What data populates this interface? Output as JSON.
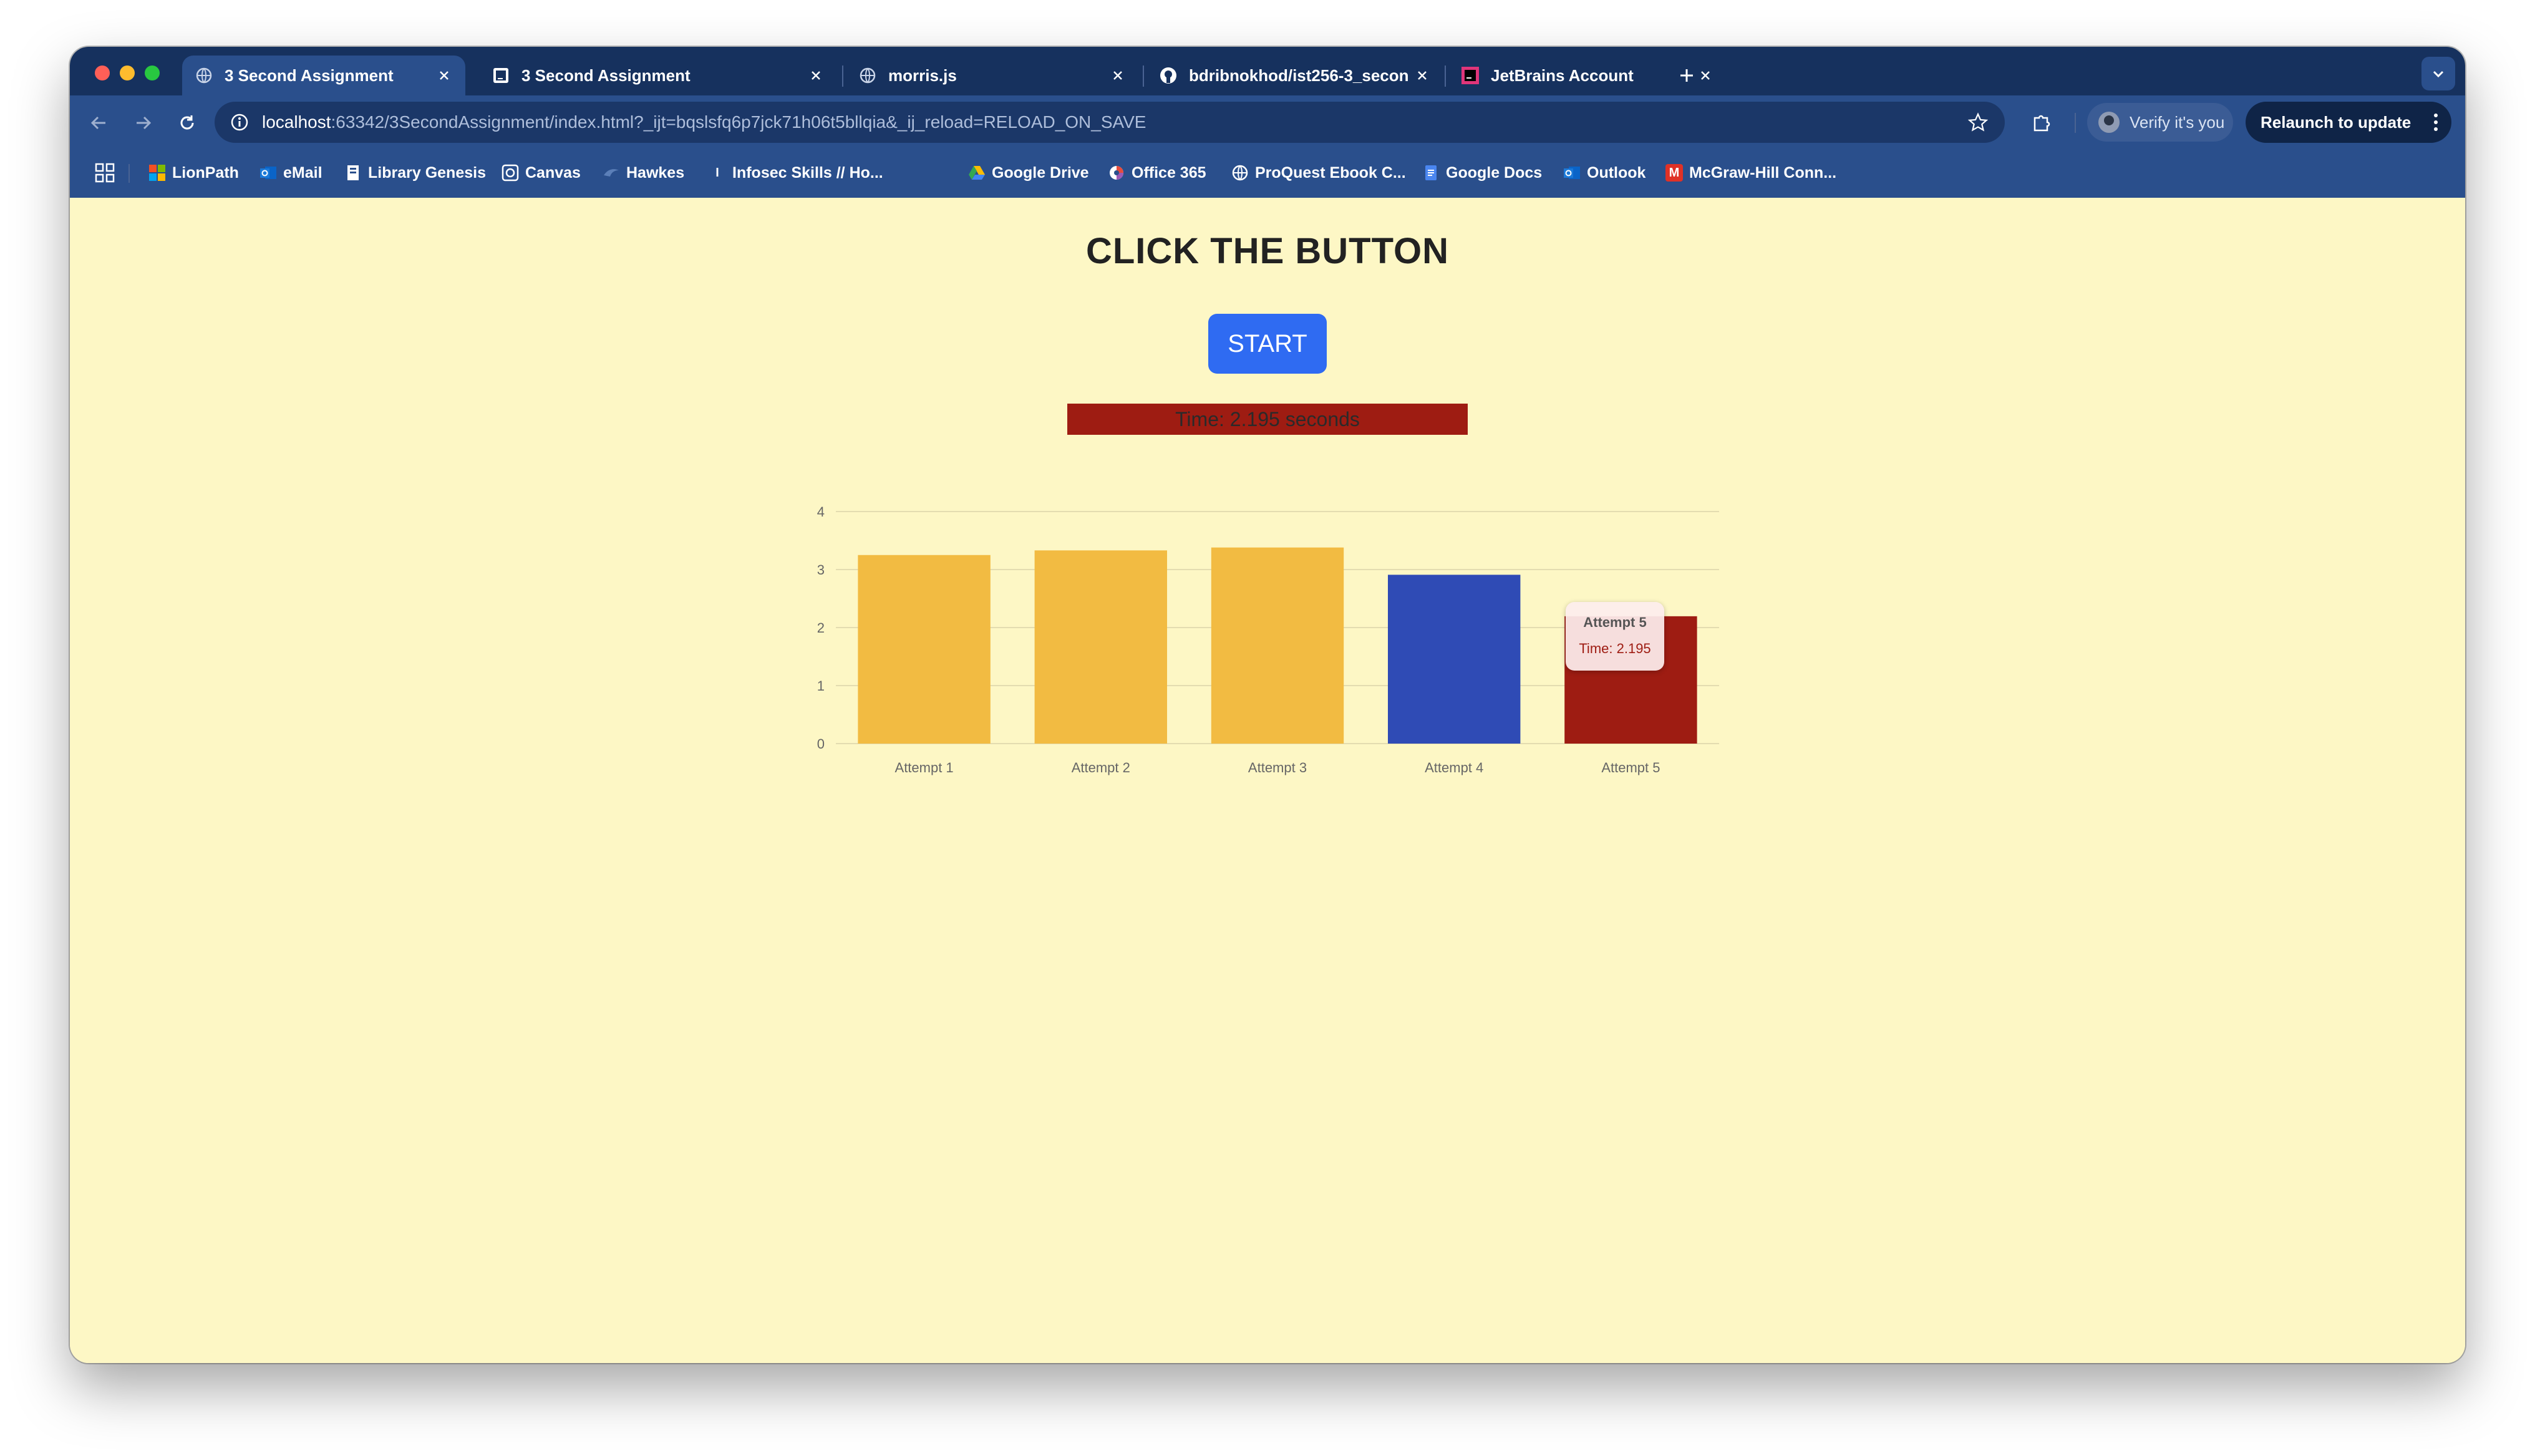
{
  "browser": {
    "tabs": [
      {
        "title": "3 Second Assignment",
        "favicon": "globe-icon",
        "active": true
      },
      {
        "title": "3 Second Assignment",
        "favicon": "webstorm-icon",
        "active": false
      },
      {
        "title": "morris.js",
        "favicon": "globe-icon",
        "active": false
      },
      {
        "title": "bdribnokhod/ist256-3_secon",
        "favicon": "github-icon",
        "active": false
      },
      {
        "title": "JetBrains Account",
        "favicon": "jetbrains-icon",
        "active": false
      }
    ],
    "url_host": "localhost",
    "url_rest": ":63342/3SecondAssignment/index.html?_ijt=bqslsfq6p7jck71h06t5bllqia&_ij_reload=RELOAD_ON_SAVE",
    "verify_label": "Verify it's you",
    "relaunch_label": "Relaunch to update",
    "bookmarks": [
      {
        "label": "LionPath",
        "icon": "microsoft-icon"
      },
      {
        "label": "eMail",
        "icon": "outlook-icon"
      },
      {
        "label": "Library Genesis",
        "icon": "book-icon"
      },
      {
        "label": "Canvas",
        "icon": "canvas-icon"
      },
      {
        "label": "Hawkes",
        "icon": "hawkes-icon"
      },
      {
        "label": "Infosec Skills // Ho...",
        "icon": "infosec-icon"
      },
      {
        "label": "Google Drive",
        "icon": "google-drive-icon"
      },
      {
        "label": "Office 365",
        "icon": "office-icon"
      },
      {
        "label": "ProQuest Ebook C...",
        "icon": "globe-icon"
      },
      {
        "label": "Google Docs",
        "icon": "google-docs-icon"
      },
      {
        "label": "Outlook",
        "icon": "outlook-icon"
      },
      {
        "label": "McGraw-Hill Conn...",
        "icon": "mcgraw-hill-icon"
      }
    ],
    "colors": {
      "chrome_dark": "#16315e",
      "chrome_toolbar": "#2a4f8c",
      "page_background": "#fdf7c5"
    }
  },
  "page": {
    "title": "CLICK THE BUTTON",
    "start_label": "START",
    "time_text": "Time: 2.195 seconds",
    "colors": {
      "start_button": "#2f6bf2",
      "time_bar": "#9e1c12"
    }
  },
  "chart_data": {
    "type": "bar",
    "categories": [
      "Attempt 1",
      "Attempt 2",
      "Attempt 3",
      "Attempt 4",
      "Attempt 5"
    ],
    "values": [
      3.25,
      3.33,
      3.38,
      2.91,
      2.195
    ],
    "bar_colors": [
      "#f2bb42",
      "#f2bb42",
      "#f2bb42",
      "#2f4bb5",
      "#9e1c12"
    ],
    "ylim": [
      0,
      4
    ],
    "yticks": [
      0,
      1,
      2,
      3,
      4
    ],
    "grid": true,
    "title": "",
    "xlabel": "",
    "ylabel": "",
    "tooltip": {
      "title": "Attempt 5",
      "body": "Time: 2.195"
    }
  }
}
